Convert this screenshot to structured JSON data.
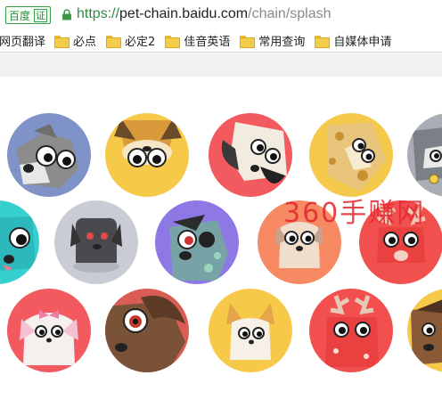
{
  "address_bar": {
    "badge_text": "百度",
    "verify_text": "证",
    "url_scheme": "https://",
    "url_host": "pet-chain.baidu.com",
    "url_path": "/chain/splash"
  },
  "bookmarks": [
    {
      "label": "网页翻译",
      "folder": false
    },
    {
      "label": "必点",
      "folder": true
    },
    {
      "label": "必定2",
      "folder": true
    },
    {
      "label": "佳音英语",
      "folder": true
    },
    {
      "label": "常用查询",
      "folder": true
    },
    {
      "label": "自媒体申请",
      "folder": true
    }
  ],
  "watermark": "360手赚网",
  "colors": {
    "secure_green": "#2f8a3e",
    "folder_yellow": "#f3cc4a",
    "watermark_red": "#e2262d"
  },
  "avatars": [
    {
      "name": "schnauzer-dog-gray",
      "bg": "#7f93c8"
    },
    {
      "name": "shiba-dog-upside-down",
      "bg": "#f7c948"
    },
    {
      "name": "white-dog-red-background",
      "bg": "#f25a60"
    },
    {
      "name": "spotted-giraffe-dog",
      "bg": "#f5c94c"
    },
    {
      "name": "gray-dog-partial",
      "bg": "#a9adb5"
    },
    {
      "name": "cyan-dog-partial",
      "bg": "#35cfd0"
    },
    {
      "name": "black-dog-gray-background",
      "bg": "#c9ccd4"
    },
    {
      "name": "pirate-eyepatch-dog",
      "bg": "#8e78e6"
    },
    {
      "name": "cream-puppy-coral-background",
      "bg": "#f78a63"
    },
    {
      "name": "reindeer-dog-red",
      "bg": "#f2504f"
    },
    {
      "name": "pink-bow-dog",
      "bg": "#f25a60"
    },
    {
      "name": "brown-dog-closeup",
      "bg": "#d95d55"
    },
    {
      "name": "corgi-yellow",
      "bg": "#f7c948"
    },
    {
      "name": "reindeer-dog-coral",
      "bg": "#f2504f"
    },
    {
      "name": "brown-dog-partial",
      "bg": "#f7c948"
    }
  ]
}
